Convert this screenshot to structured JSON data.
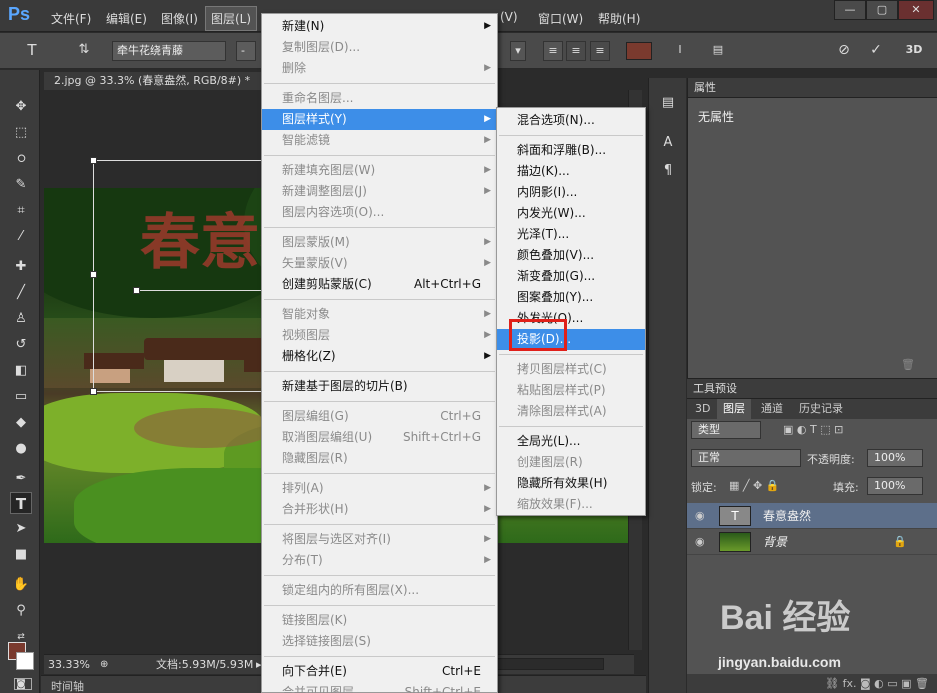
{
  "app": {
    "logo": "Ps",
    "menus": [
      "文件(F)",
      "编辑(E)",
      "图像(I)",
      "图层(L)",
      "(V)",
      "窗口(W)",
      "帮助(H)"
    ],
    "window_controls": [
      "—",
      "▢",
      "✕"
    ]
  },
  "options": {
    "font_family": "牵牛花绕青藤",
    "dash": "-",
    "icons": [
      "text-tool-icon",
      "text-orient-icon",
      "align-left-icon",
      "align-center-icon",
      "align-right-icon",
      "warp-text-icon",
      "panel-icon",
      "cancel-icon",
      "commit-icon",
      "3d-label"
    ],
    "label_3d": "3D",
    "text_color": "#7a3a2e"
  },
  "document": {
    "tab_title": "2.jpg @ 33.3% (春意盎然, RGB/8#) *",
    "watermark_text": "春意盎然",
    "zoom": "33.33%",
    "file_size": "文档:5.93M/5.93M",
    "timeline": "时间轴"
  },
  "layer_menu": {
    "items": [
      {
        "label": "新建(N)",
        "arrow": true,
        "dis": false
      },
      {
        "label": "复制图层(D)...",
        "dis": true
      },
      {
        "label": "删除",
        "arrow": true,
        "dis": true
      },
      {
        "sep": true
      },
      {
        "label": "重命名图层...",
        "dis": true
      },
      {
        "label": "图层样式(Y)",
        "arrow": true,
        "hi": true
      },
      {
        "label": "智能滤镜",
        "arrow": true,
        "dis": true
      },
      {
        "sep": true
      },
      {
        "label": "新建填充图层(W)",
        "arrow": true,
        "dis": true
      },
      {
        "label": "新建调整图层(J)",
        "arrow": true,
        "dis": true
      },
      {
        "label": "图层内容选项(O)...",
        "dis": true
      },
      {
        "sep": true
      },
      {
        "label": "图层蒙版(M)",
        "arrow": true,
        "dis": true
      },
      {
        "label": "矢量蒙版(V)",
        "arrow": true,
        "dis": true
      },
      {
        "label": "创建剪贴蒙版(C)",
        "shortcut": "Alt+Ctrl+G"
      },
      {
        "sep": true
      },
      {
        "label": "智能对象",
        "arrow": true,
        "dis": true
      },
      {
        "label": "视频图层",
        "arrow": true,
        "dis": true
      },
      {
        "label": "栅格化(Z)",
        "arrow": true
      },
      {
        "sep": true
      },
      {
        "label": "新建基于图层的切片(B)"
      },
      {
        "sep": true
      },
      {
        "label": "图层编组(G)",
        "shortcut": "Ctrl+G",
        "dis": true
      },
      {
        "label": "取消图层编组(U)",
        "shortcut": "Shift+Ctrl+G",
        "dis": true
      },
      {
        "label": "隐藏图层(R)",
        "dis": true
      },
      {
        "sep": true
      },
      {
        "label": "排列(A)",
        "arrow": true,
        "dis": true
      },
      {
        "label": "合并形状(H)",
        "arrow": true,
        "dis": true
      },
      {
        "sep": true
      },
      {
        "label": "将图层与选区对齐(I)",
        "arrow": true,
        "dis": true
      },
      {
        "label": "分布(T)",
        "arrow": true,
        "dis": true
      },
      {
        "sep": true
      },
      {
        "label": "锁定组内的所有图层(X)...",
        "dis": true
      },
      {
        "sep": true
      },
      {
        "label": "链接图层(K)",
        "dis": true
      },
      {
        "label": "选择链接图层(S)",
        "dis": true
      },
      {
        "sep": true
      },
      {
        "label": "向下合并(E)",
        "shortcut": "Ctrl+E"
      },
      {
        "label": "合并可见图层",
        "shortcut": "Shift+Ctrl+E",
        "dis": true
      }
    ]
  },
  "style_menu": {
    "items": [
      {
        "label": "混合选项(N)..."
      },
      {
        "sep": true
      },
      {
        "label": "斜面和浮雕(B)..."
      },
      {
        "label": "描边(K)..."
      },
      {
        "label": "内阴影(I)..."
      },
      {
        "label": "内发光(W)..."
      },
      {
        "label": "光泽(T)..."
      },
      {
        "label": "颜色叠加(V)..."
      },
      {
        "label": "渐变叠加(G)..."
      },
      {
        "label": "图案叠加(Y)..."
      },
      {
        "label": "外发光(O)..."
      },
      {
        "label": "投影(D)...",
        "hi": true
      },
      {
        "sep": true
      },
      {
        "label": "拷贝图层样式(C)",
        "dis": true
      },
      {
        "label": "粘贴图层样式(P)",
        "dis": true
      },
      {
        "label": "清除图层样式(A)",
        "dis": true
      },
      {
        "sep": true
      },
      {
        "label": "全局光(L)..."
      },
      {
        "label": "创建图层(R)",
        "dis": true
      },
      {
        "label": "隐藏所有效果(H)"
      },
      {
        "label": "缩放效果(F)...",
        "dis": true
      }
    ]
  },
  "properties": {
    "title": "属性",
    "empty": "无属性"
  },
  "presets": {
    "title": "工具预设"
  },
  "layers_panel": {
    "tabs": [
      "3D",
      "图层",
      "通道",
      "历史记录"
    ],
    "filter": "类型",
    "blend": "正常",
    "opacity_label": "不透明度:",
    "opacity": "100%",
    "lock_label": "锁定:",
    "fill_label": "填充:",
    "fill": "100%",
    "layers": [
      {
        "name": "春意盎然",
        "type": "text",
        "selected": true
      },
      {
        "name": "背景",
        "type": "image",
        "locked": true
      }
    ]
  },
  "branding": {
    "logo": "Bai 经验",
    "url": "jingyan.baidu.com"
  }
}
